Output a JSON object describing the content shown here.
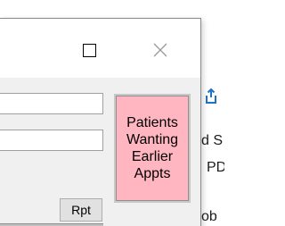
{
  "background_app": {
    "fragments": [
      "d S",
      "PD",
      "ob"
    ],
    "icon_color": "#1e73c9"
  },
  "window": {
    "title_buttons": {
      "maximize": "maximize",
      "close": "close"
    },
    "rpt_button_label": "Rpt",
    "patients_button": {
      "lines": [
        "Patients",
        "Wanting",
        "Earlier",
        "Appts"
      ],
      "color": "#ffb6c1"
    }
  }
}
